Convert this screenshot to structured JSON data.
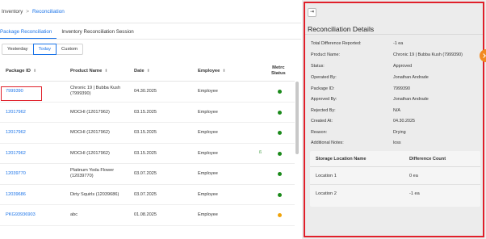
{
  "breadcrumb": {
    "root": "Inventory",
    "separator": ">",
    "current": "Reconciliation"
  },
  "tabs": [
    {
      "label": "Package Reconciliation",
      "active": true
    },
    {
      "label": "Inventory Reconciliation Session",
      "active": false
    }
  ],
  "filters": [
    {
      "label": "Yesterday",
      "active": false
    },
    {
      "label": "Today",
      "active": true
    },
    {
      "label": "Custom",
      "active": false
    }
  ],
  "table": {
    "headers": {
      "package_id": "Package ID",
      "product_name": "Product Name",
      "date": "Date",
      "employee": "Employee",
      "metrc_line1": "Metrc",
      "metrc_line2": "Status"
    },
    "sort_glyph": "⬍",
    "rows": [
      {
        "package_id": "7999390",
        "product_line1": "Chronic 19 | Bubba Kush",
        "product_line2": "(7999390)",
        "date": "04.30.2025",
        "employee": "Employee",
        "status": "green"
      },
      {
        "package_id": "12017962",
        "product_line1": "MOCHI (12017962)",
        "product_line2": "",
        "date": "03.15.2025",
        "employee": "Employee",
        "status": "green"
      },
      {
        "package_id": "12017962",
        "product_line1": "MOCHI (12017962)",
        "product_line2": "",
        "date": "03.15.2025",
        "employee": "Employee",
        "status": "green"
      },
      {
        "package_id": "12017962",
        "product_line1": "MOCHI (12017962)",
        "product_line2": "",
        "date": "03.15.2025",
        "employee": "Employee",
        "status": "green"
      },
      {
        "package_id": "12039770",
        "product_line1": "Platinum Yoda Flower",
        "product_line2": "(12039770)",
        "date": "03.07.2025",
        "employee": "Employee",
        "status": "green"
      },
      {
        "package_id": "12039686",
        "product_line1": "Dirty Squirls (12039686)",
        "product_line2": "",
        "date": "03.07.2025",
        "employee": "Employee",
        "status": "green"
      },
      {
        "package_id": "PKG93936903",
        "product_line1": "abc",
        "product_line2": "",
        "date": "01.08.2025",
        "employee": "Employee",
        "status": "orange"
      }
    ]
  },
  "stray_mark": "ß",
  "details": {
    "exit_icon": "⇥",
    "title": "Reconciliation Details",
    "fields": [
      {
        "label": "Total Difference Reported:",
        "value": "-1 ea"
      },
      {
        "label": "Product Name:",
        "value": "Chronic 19 | Bubba Kush (7999390)"
      },
      {
        "label": "Status:",
        "value": "Approved"
      },
      {
        "label": "Operated By:",
        "value": "Jonathan Andrade"
      },
      {
        "label": "Package ID:",
        "value": "7999390"
      },
      {
        "label": "Approved By:",
        "value": "Jonathan Andrade"
      },
      {
        "label": "Rejected By:",
        "value": "N/A"
      },
      {
        "label": "Created At:",
        "value": "04.30.2025"
      },
      {
        "label": "Reason:",
        "value": "Drying"
      },
      {
        "label": "Additional Notes:",
        "value": "loss"
      }
    ],
    "locations": {
      "header_location": "Storage Location Name",
      "header_diff": "Difference Count",
      "rows": [
        {
          "name": "Location 1",
          "count": "0 ea"
        },
        {
          "name": "Location 2",
          "count": "-1 ea"
        }
      ]
    }
  },
  "colors": {
    "accent": "#1a73e8",
    "highlight": "#e0202a",
    "status_ok": "#1b8a1b",
    "status_warn": "#f0a30a",
    "edge_tab": "#f28a21"
  }
}
